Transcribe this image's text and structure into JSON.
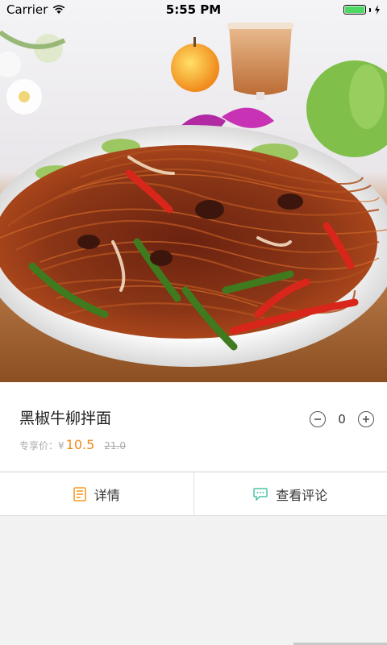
{
  "status_bar": {
    "carrier": "Carrier",
    "time": "5:55 PM",
    "battery_level": 1.0
  },
  "hero": {
    "image_subject": "Stir-fried noodles with peppers and onions on a white plate"
  },
  "product": {
    "name": "黑椒牛柳拌面",
    "price_label": "专享价：",
    "currency_symbol": "¥",
    "price": "10.5",
    "original_price": "21.0"
  },
  "stepper": {
    "quantity": "0",
    "decrement_icon": "minus-circle-icon",
    "increment_icon": "plus-circle-icon"
  },
  "tabs": [
    {
      "label": "详情",
      "icon": "document-icon",
      "icon_color": "#f39c24"
    },
    {
      "label": "查看评论",
      "icon": "comment-icon",
      "icon_color": "#4cc4a6"
    }
  ],
  "colors": {
    "accent_price": "#f08a1c",
    "battery": "#4cd964"
  }
}
